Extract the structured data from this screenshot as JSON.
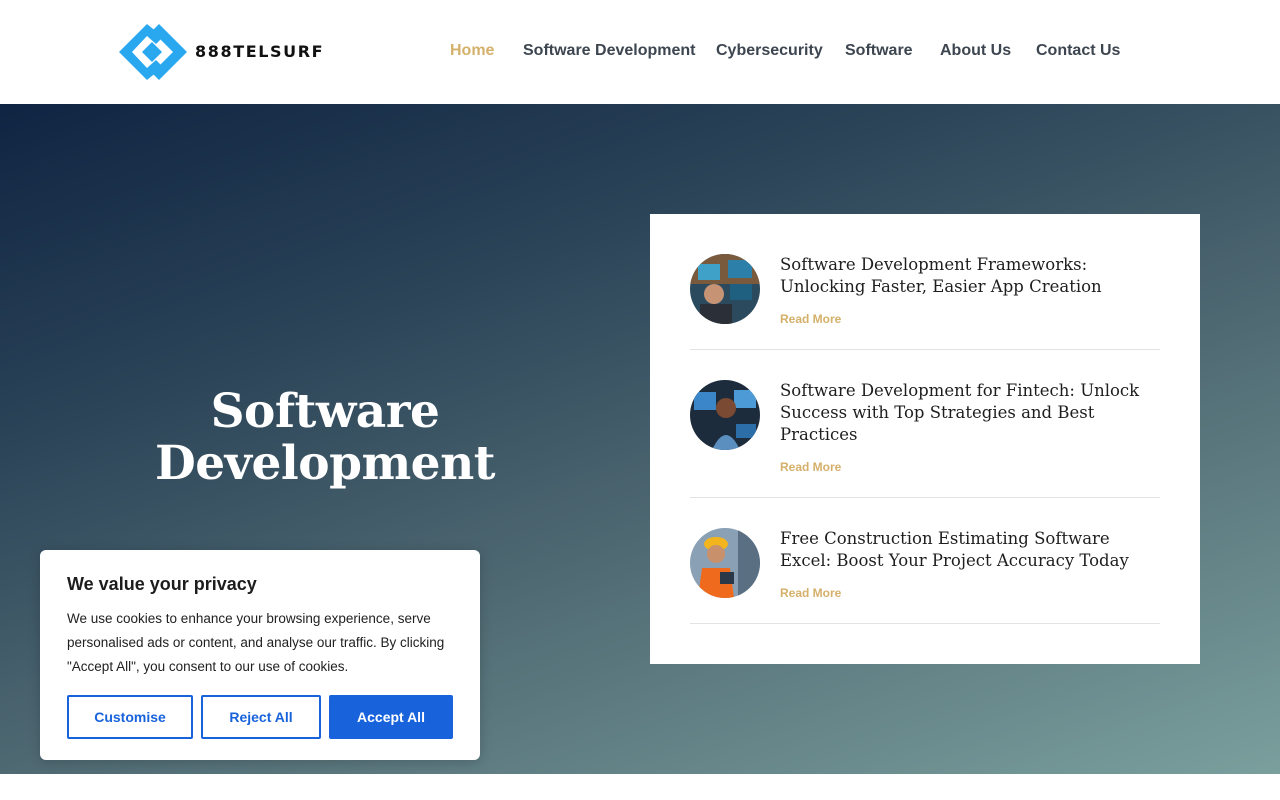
{
  "header": {
    "logo_text": "888TELSURF",
    "nav": [
      {
        "label": "Home",
        "active": true
      },
      {
        "label": "Software Development"
      },
      {
        "label": "Cybersecurity"
      },
      {
        "label": "Software"
      },
      {
        "label": "About Us"
      },
      {
        "label": "Contact Us"
      }
    ]
  },
  "hero": {
    "title_line1": "Software",
    "title_line2": "Development"
  },
  "posts": [
    {
      "title": "Software Development Frameworks: Unlocking Faster, Easier App Creation",
      "read_more": "Read More"
    },
    {
      "title": "Software Development for Fintech: Unlock Success with Top Strategies and Best Practices",
      "read_more": "Read More"
    },
    {
      "title": "Free Construction Estimating Software Excel: Boost Your Project Accuracy Today",
      "read_more": "Read More"
    }
  ],
  "cookie": {
    "title": "We value your privacy",
    "text": "We use cookies to enhance your browsing experience, serve personalised ads or content, and analyse our traffic. By clicking \"Accept All\", you consent to our use of cookies.",
    "customise_label": "Customise",
    "reject_label": "Reject All",
    "accept_label": "Accept All"
  },
  "colors": {
    "accent_gold": "#d4b06a",
    "logo_blue": "#29a8f0",
    "cookie_blue": "#1863dc"
  }
}
